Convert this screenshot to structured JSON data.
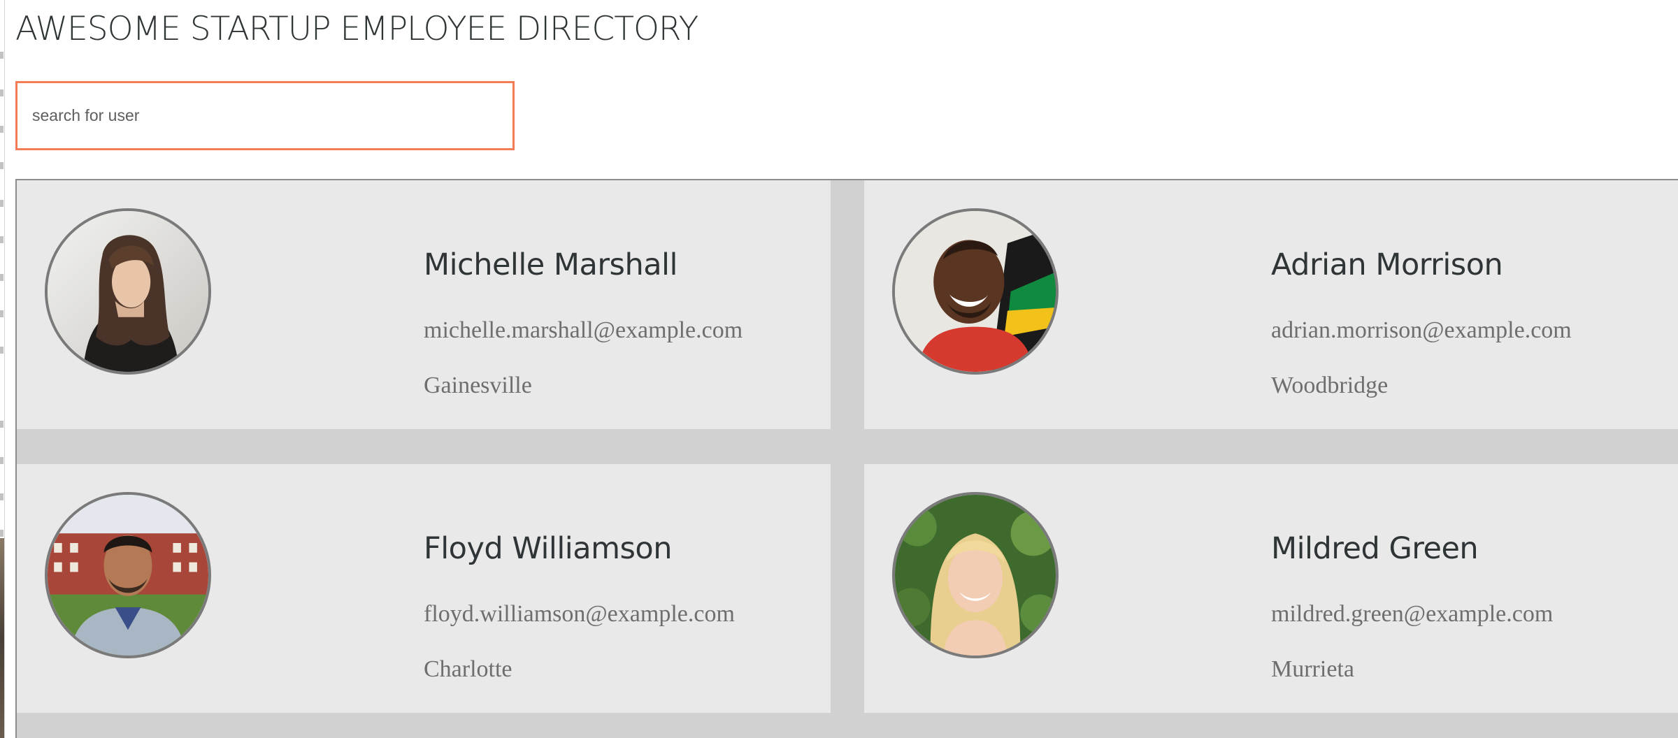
{
  "page": {
    "title": "AWESOME STARTUP EMPLOYEE DIRECTORY"
  },
  "search": {
    "placeholder": "search for user",
    "value": ""
  },
  "colors": {
    "search_border": "#f47d57",
    "card_background": "#e8e9e8",
    "grid_background": "#d1d1d1",
    "name_text": "#2f3436",
    "detail_text": "#6e6e6e"
  },
  "employees": [
    {
      "name": "Michelle Marshall",
      "email": "michelle.marshall@example.com",
      "city": "Gainesville",
      "avatar_icon": "person-photo-icon"
    },
    {
      "name": "Adrian Morrison",
      "email": "adrian.morrison@example.com",
      "city": "Woodbridge",
      "avatar_icon": "person-photo-icon"
    },
    {
      "name": "Floyd Williamson",
      "email": "floyd.williamson@example.com",
      "city": "Charlotte",
      "avatar_icon": "person-photo-icon"
    },
    {
      "name": "Mildred Green",
      "email": "mildred.green@example.com",
      "city": "Murrieta",
      "avatar_icon": "person-photo-icon"
    }
  ]
}
